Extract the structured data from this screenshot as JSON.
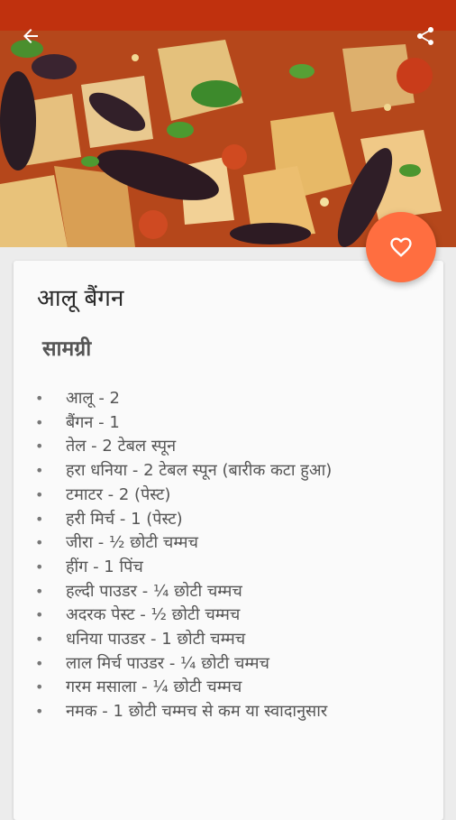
{
  "colors": {
    "status_bar": "#c0310e",
    "fab": "#ff6e40",
    "card": "#fafafa",
    "background": "#ececec"
  },
  "toolbar": {
    "back_icon": "arrow-left-icon",
    "share_icon": "share-icon"
  },
  "hero": {
    "description_icon": "food-photo"
  },
  "fab": {
    "icon": "heart-outline-icon"
  },
  "recipe": {
    "title": "आलू बैंगन",
    "ingredients_heading": "सामग्री",
    "ingredients": [
      "आलू - 2",
      "बैंगन - 1",
      "तेल - 2 टेबल स्पून",
      "हरा धनिया - 2 टेबल स्पून (बारीक कटा हुआ)",
      "टमाटर - 2 (पेस्ट)",
      "हरी मिर्च - 1 (पेस्ट)",
      "जीरा - ½ छोटी चम्मच",
      "हींग - 1 पिंच",
      "हल्दी पाउडर - ¼ छोटी चम्मच",
      "अदरक पेस्ट - ½ छोटी चम्मच",
      "धनिया पाउडर - 1 छोटी चम्मच",
      "लाल मिर्च पाउडर - ¼ छोटी चम्मच",
      "गरम मसाला - ¼ छोटी चम्मच",
      "नमक - 1 छोटी चम्मच से कम या स्वादानुसार"
    ]
  }
}
